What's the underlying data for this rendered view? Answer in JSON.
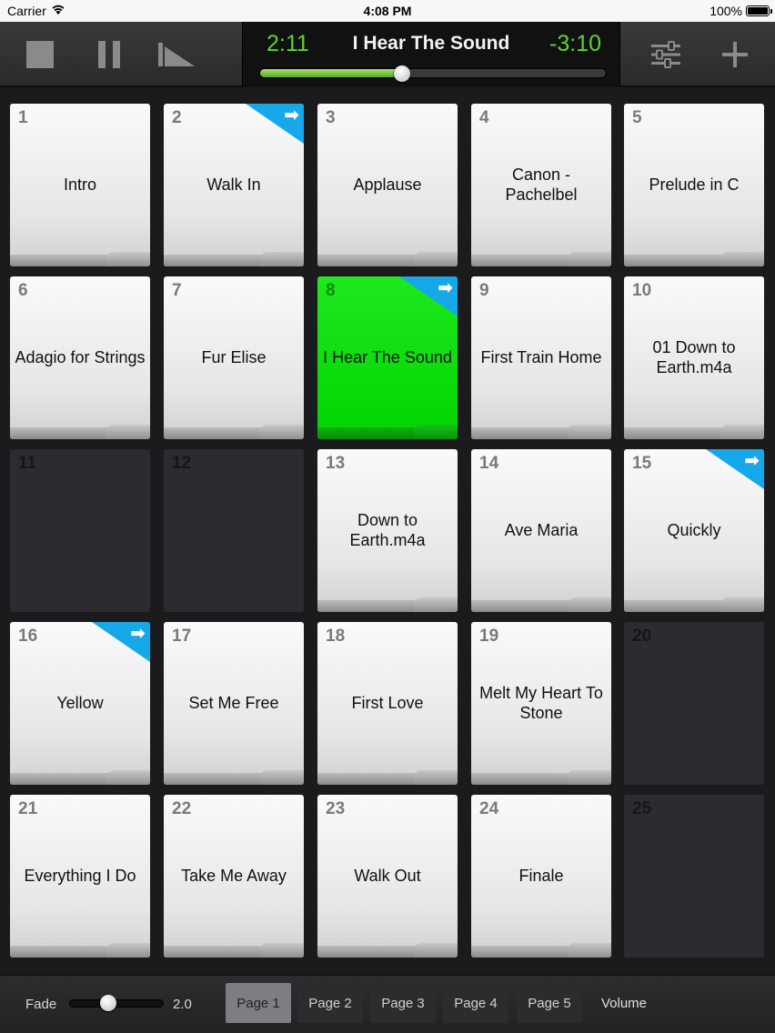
{
  "status_bar": {
    "carrier": "Carrier",
    "time": "4:08 PM",
    "battery": "100%"
  },
  "player": {
    "elapsed": "2:11",
    "title": "I Hear The Sound",
    "remaining": "-3:10",
    "progress": 0.41
  },
  "toolbar": {
    "icons": [
      "stop-icon",
      "pause-icon",
      "fade-out-icon",
      "settings-sliders-icon",
      "add-icon"
    ]
  },
  "colors": {
    "elapsed": "#5cd42a",
    "playing_tile": "#00d400",
    "link_corner": "#16a8e8"
  },
  "tiles": [
    {
      "num": "1",
      "label": "Intro",
      "state": "filled",
      "link": false
    },
    {
      "num": "2",
      "label": "Walk In",
      "state": "filled",
      "link": true
    },
    {
      "num": "3",
      "label": "Applause",
      "state": "filled",
      "link": false
    },
    {
      "num": "4",
      "label": "Canon - Pachelbel",
      "state": "filled",
      "link": false
    },
    {
      "num": "5",
      "label": "Prelude in C",
      "state": "filled",
      "link": false
    },
    {
      "num": "6",
      "label": "Adagio for Strings",
      "state": "filled",
      "link": false
    },
    {
      "num": "7",
      "label": "Fur Elise",
      "state": "filled",
      "link": false
    },
    {
      "num": "8",
      "label": "I Hear The Sound",
      "state": "playing",
      "link": true
    },
    {
      "num": "9",
      "label": "First Train Home",
      "state": "filled",
      "link": false
    },
    {
      "num": "10",
      "label": "01 Down to Earth.m4a",
      "state": "filled",
      "link": false
    },
    {
      "num": "11",
      "label": "",
      "state": "empty",
      "link": false
    },
    {
      "num": "12",
      "label": "",
      "state": "empty",
      "link": false
    },
    {
      "num": "13",
      "label": "Down to Earth.m4a",
      "state": "filled",
      "link": false
    },
    {
      "num": "14",
      "label": "Ave Maria",
      "state": "filled",
      "link": false
    },
    {
      "num": "15",
      "label": "Quickly",
      "state": "filled",
      "link": true
    },
    {
      "num": "16",
      "label": "Yellow",
      "state": "filled",
      "link": true
    },
    {
      "num": "17",
      "label": "Set Me Free",
      "state": "filled",
      "link": false
    },
    {
      "num": "18",
      "label": "First Love",
      "state": "filled",
      "link": false
    },
    {
      "num": "19",
      "label": "Melt My Heart To Stone",
      "state": "filled",
      "link": false
    },
    {
      "num": "20",
      "label": "",
      "state": "empty",
      "link": false
    },
    {
      "num": "21",
      "label": "Everything I Do",
      "state": "filled",
      "link": false
    },
    {
      "num": "22",
      "label": "Take Me Away",
      "state": "filled",
      "link": false
    },
    {
      "num": "23",
      "label": "Walk Out",
      "state": "filled",
      "link": false
    },
    {
      "num": "24",
      "label": "Finale",
      "state": "filled",
      "link": false
    },
    {
      "num": "25",
      "label": "",
      "state": "empty",
      "link": false
    }
  ],
  "bottom": {
    "fade_label": "Fade",
    "fade_value": "2.0",
    "fade_level": 0.41,
    "pages": [
      "Page 1",
      "Page 2",
      "Page 3",
      "Page 4",
      "Page 5"
    ],
    "active_page": 0,
    "volume_label": "Volume"
  }
}
